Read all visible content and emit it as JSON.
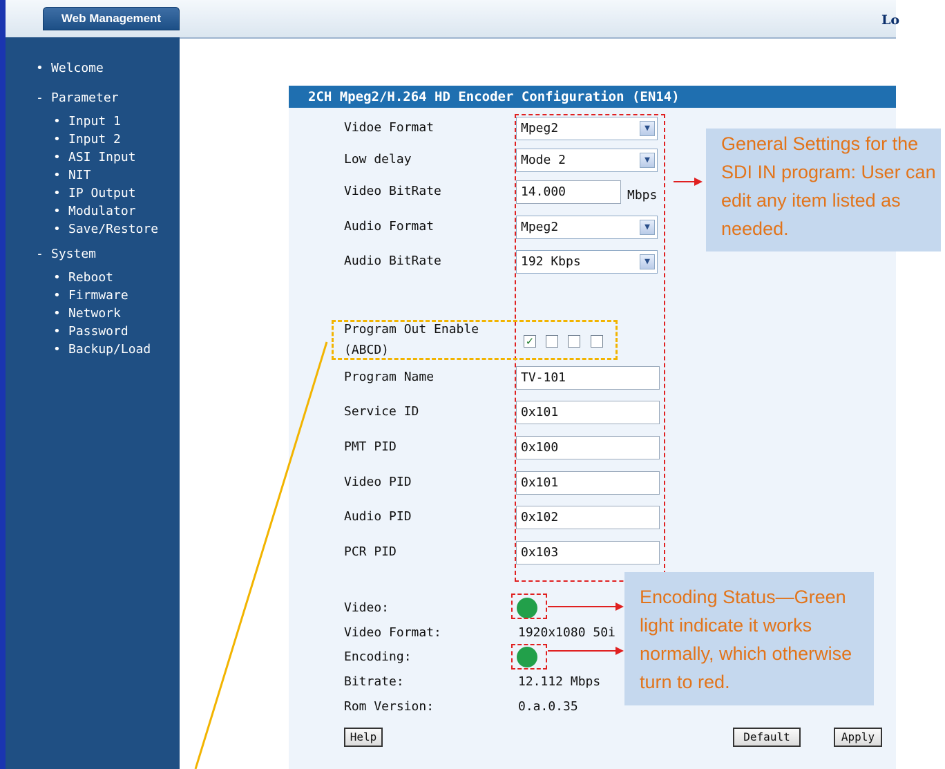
{
  "header": {
    "brand": "Web Management",
    "right_text": "Lo"
  },
  "sidebar": {
    "items": [
      {
        "bullet": "•",
        "label": "Welcome"
      },
      {
        "bullet": "-",
        "label": "Parameter"
      },
      {
        "bullet": "•",
        "label": "Input 1"
      },
      {
        "bullet": "•",
        "label": "Input 2"
      },
      {
        "bullet": "•",
        "label": "ASI Input"
      },
      {
        "bullet": "•",
        "label": "NIT"
      },
      {
        "bullet": "•",
        "label": "IP Output"
      },
      {
        "bullet": "•",
        "label": "Modulator"
      },
      {
        "bullet": "•",
        "label": "Save/Restore"
      },
      {
        "bullet": "-",
        "label": "System"
      },
      {
        "bullet": "•",
        "label": "Reboot"
      },
      {
        "bullet": "•",
        "label": "Firmware"
      },
      {
        "bullet": "•",
        "label": "Network"
      },
      {
        "bullet": "•",
        "label": "Password"
      },
      {
        "bullet": "•",
        "label": "Backup/Load"
      }
    ]
  },
  "panel": {
    "title": "2CH Mpeg2/H.264 HD Encoder Configuration (EN14)",
    "video_format": {
      "label": "Vidoe Format",
      "value": "Mpeg2"
    },
    "low_delay": {
      "label": "Low delay",
      "value": "Mode 2"
    },
    "video_bitrate": {
      "label": "Video BitRate",
      "value": "14.000",
      "unit": "Mbps"
    },
    "audio_format": {
      "label": "Audio Format",
      "value": "Mpeg2"
    },
    "audio_bitrate": {
      "label": "Audio BitRate",
      "value": "192 Kbps"
    },
    "program_out": {
      "label_line1": "Program Out Enable",
      "label_line2": "(ABCD)",
      "check_mark": "✓",
      "checked": [
        true,
        false,
        false,
        false
      ]
    },
    "program_name": {
      "label": "Program Name",
      "value": "TV-101"
    },
    "service_id": {
      "label": "Service ID",
      "value": "0x101"
    },
    "pmt_pid": {
      "label": "PMT PID",
      "value": "0x100"
    },
    "video_pid": {
      "label": "Video PID",
      "value": "0x101"
    },
    "audio_pid": {
      "label": "Audio PID",
      "value": "0x102"
    },
    "pcr_pid": {
      "label": "PCR PID",
      "value": "0x103"
    },
    "status": {
      "video_label": "Video:",
      "video_format_label": "Video Format:",
      "video_format_value": "1920x1080 50i",
      "encoding_label": "Encoding:",
      "bitrate_label": "Bitrate:",
      "bitrate_value": "12.112 Mbps",
      "rom_label": "Rom Version:",
      "rom_value": "0.a.0.35",
      "led_color": "#22a04a"
    },
    "buttons": {
      "help": "Help",
      "default": "Default",
      "apply": "Apply"
    }
  },
  "annotations": {
    "general_settings": "General Settings for the SDI IN program: User can edit any item listed as needed.",
    "encoding_status": "Encoding Status—Green light indicate it works normally, which otherwise turn to red."
  },
  "colors": {
    "sidebar": "#1f4f83",
    "panel_header": "#1f6fb0",
    "callout_bg": "#c5d8ee",
    "callout_text": "#e2741a",
    "red_dash": "#e02020",
    "yellow_dash": "#f2b400"
  }
}
